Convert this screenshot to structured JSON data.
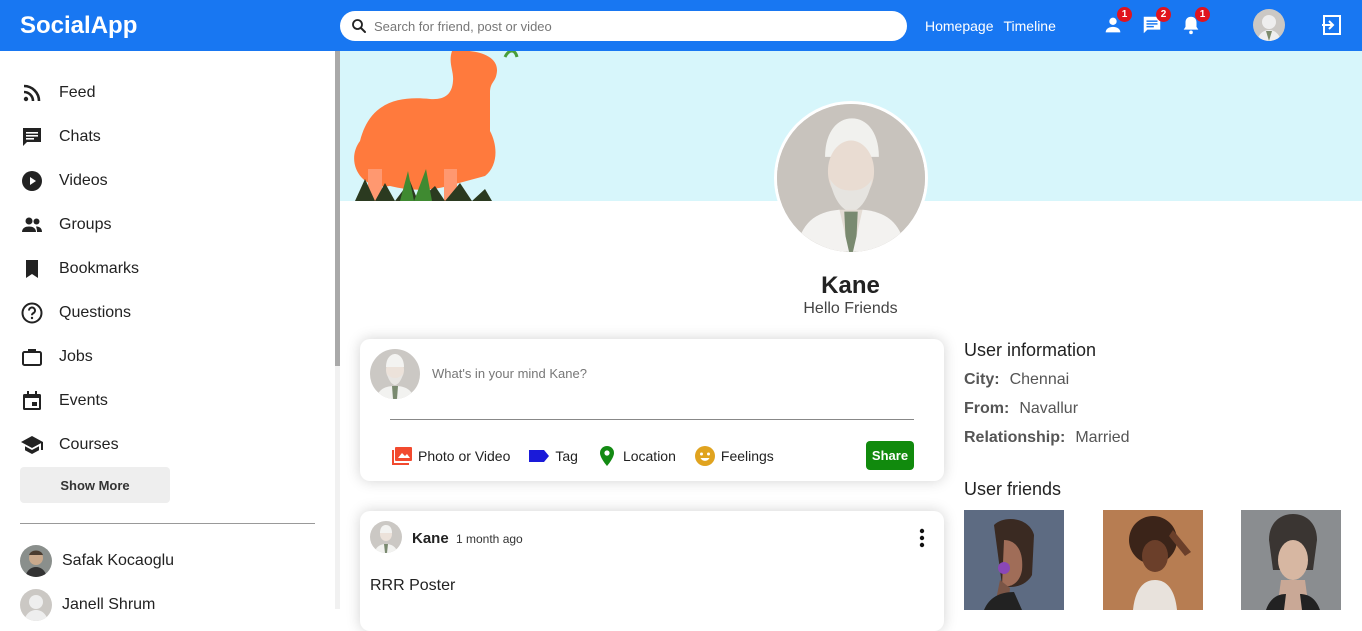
{
  "topbar": {
    "logo": "SocialApp",
    "search_placeholder": "Search for friend, post or video",
    "links": [
      "Homepage",
      "Timeline"
    ],
    "badges": {
      "friends": "1",
      "messages": "2",
      "notifications": "1"
    }
  },
  "sidebar": {
    "items": [
      {
        "label": "Feed",
        "icon": "rss-feed-icon"
      },
      {
        "label": "Chats",
        "icon": "chat-icon"
      },
      {
        "label": "Videos",
        "icon": "play-circle-icon"
      },
      {
        "label": "Groups",
        "icon": "group-icon"
      },
      {
        "label": "Bookmarks",
        "icon": "bookmark-icon"
      },
      {
        "label": "Questions",
        "icon": "help-circle-icon"
      },
      {
        "label": "Jobs",
        "icon": "work-icon"
      },
      {
        "label": "Events",
        "icon": "event-icon"
      },
      {
        "label": "Courses",
        "icon": "school-icon"
      }
    ],
    "show_more": "Show More",
    "friends": [
      "Safak Kocaoglu",
      "Janell Shrum"
    ]
  },
  "profile": {
    "name": "Kane",
    "description": "Hello Friends"
  },
  "share": {
    "placeholder": "What's in your mind Kane?",
    "options": [
      "Photo or Video",
      "Tag",
      "Location",
      "Feelings"
    ],
    "button": "Share"
  },
  "post": {
    "username": "Kane",
    "date": "1 month ago",
    "text": "RRR Poster"
  },
  "user_info": {
    "title": "User information",
    "city_label": "City:",
    "city": "Chennai",
    "from_label": "From:",
    "from": "Navallur",
    "relationship_label": "Relationship:",
    "relationship": "Married"
  },
  "user_friends": {
    "title": "User friends"
  },
  "colors": {
    "primary": "#1877f2",
    "share_button": "#118a0d",
    "badge": "#e0141e",
    "cover": "#d7f6fb"
  }
}
